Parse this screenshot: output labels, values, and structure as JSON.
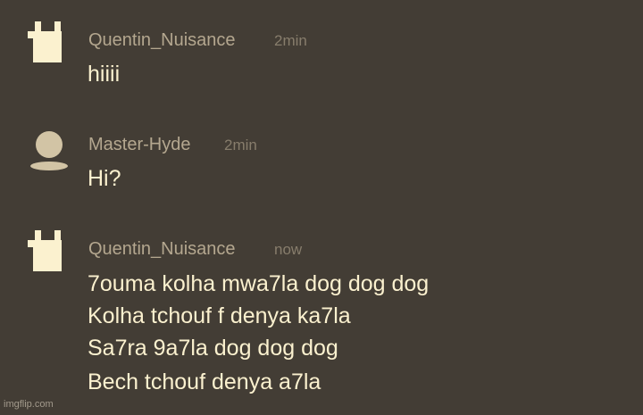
{
  "messages": [
    {
      "author": "Quentin_Nuisance",
      "time": "2min",
      "avatar_icon": "pixel-bunny-icon",
      "lines": [
        "hiiii"
      ]
    },
    {
      "author": "Master-Hyde",
      "time": "2min",
      "avatar_icon": "default-user-icon",
      "lines": [
        "Hi?"
      ]
    },
    {
      "author": "Quentin_Nuisance",
      "time": "now",
      "avatar_icon": "pixel-bunny-icon",
      "lines": [
        "7ouma kolha mwa7la dog dog dog",
        "Kolha tchouf f denya ka7la",
        "Sa7ra 9a7la dog dog dog",
        "Bech tchouf denya a7la"
      ]
    }
  ],
  "watermark": "imgflip.com",
  "colors": {
    "background": "#433d35",
    "author": "#b4a78f",
    "timestamp": "#877d6c",
    "message_text": "#fbf1cf",
    "avatar_bunny": "#fbf1cf",
    "avatar_default": "#d2c4a5"
  }
}
